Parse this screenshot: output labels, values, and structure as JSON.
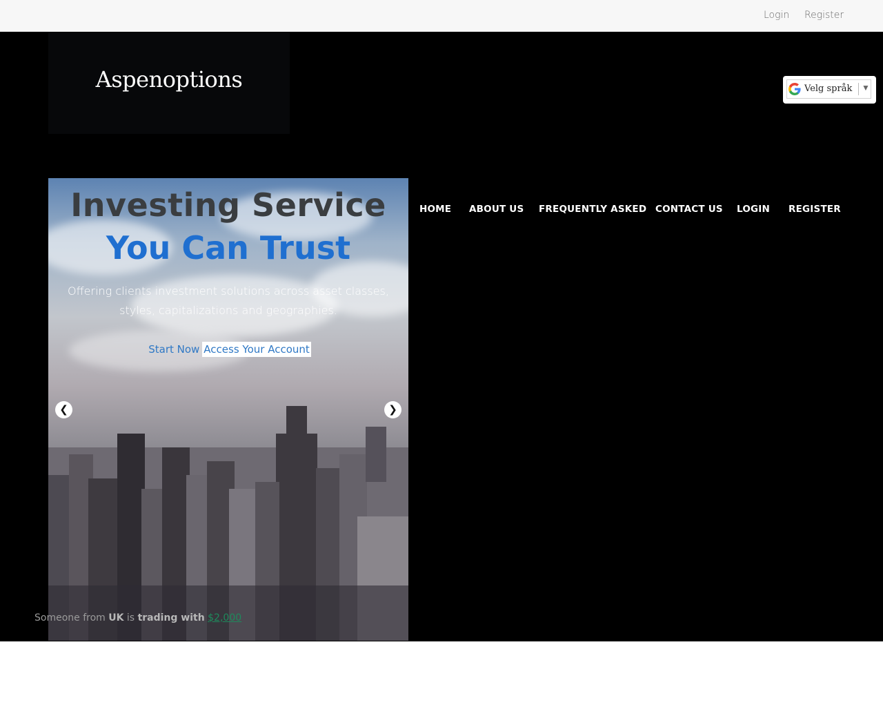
{
  "topbar": {
    "login": "Login",
    "register": "Register"
  },
  "brand": {
    "name": "Aspenoptions"
  },
  "language": {
    "label": "Velg språk",
    "arrow": "▼"
  },
  "nav": {
    "items": [
      "HOME",
      "ABOUT US",
      "FREQUENTLY ASKED",
      "CONTACT US",
      "LOGIN",
      "REGISTER"
    ]
  },
  "hero": {
    "title_line1": "Investing Service",
    "title_line2": "You Can Trust",
    "subtitle": "Offering clients investment solutions across asset classes, styles, capitalizations and geographies.",
    "start_button": "Start Now",
    "access_button": "Access Your Account",
    "prev_arrow": "❮",
    "next_arrow": "❯"
  },
  "notification": {
    "prefix": "Someone from",
    "country": "UK",
    "middle": "is",
    "action": "trading with",
    "amount": "$2,000"
  },
  "colors": {
    "accent": "#1f6fd0",
    "amount": "#1e8a5c",
    "background": "#000000"
  }
}
